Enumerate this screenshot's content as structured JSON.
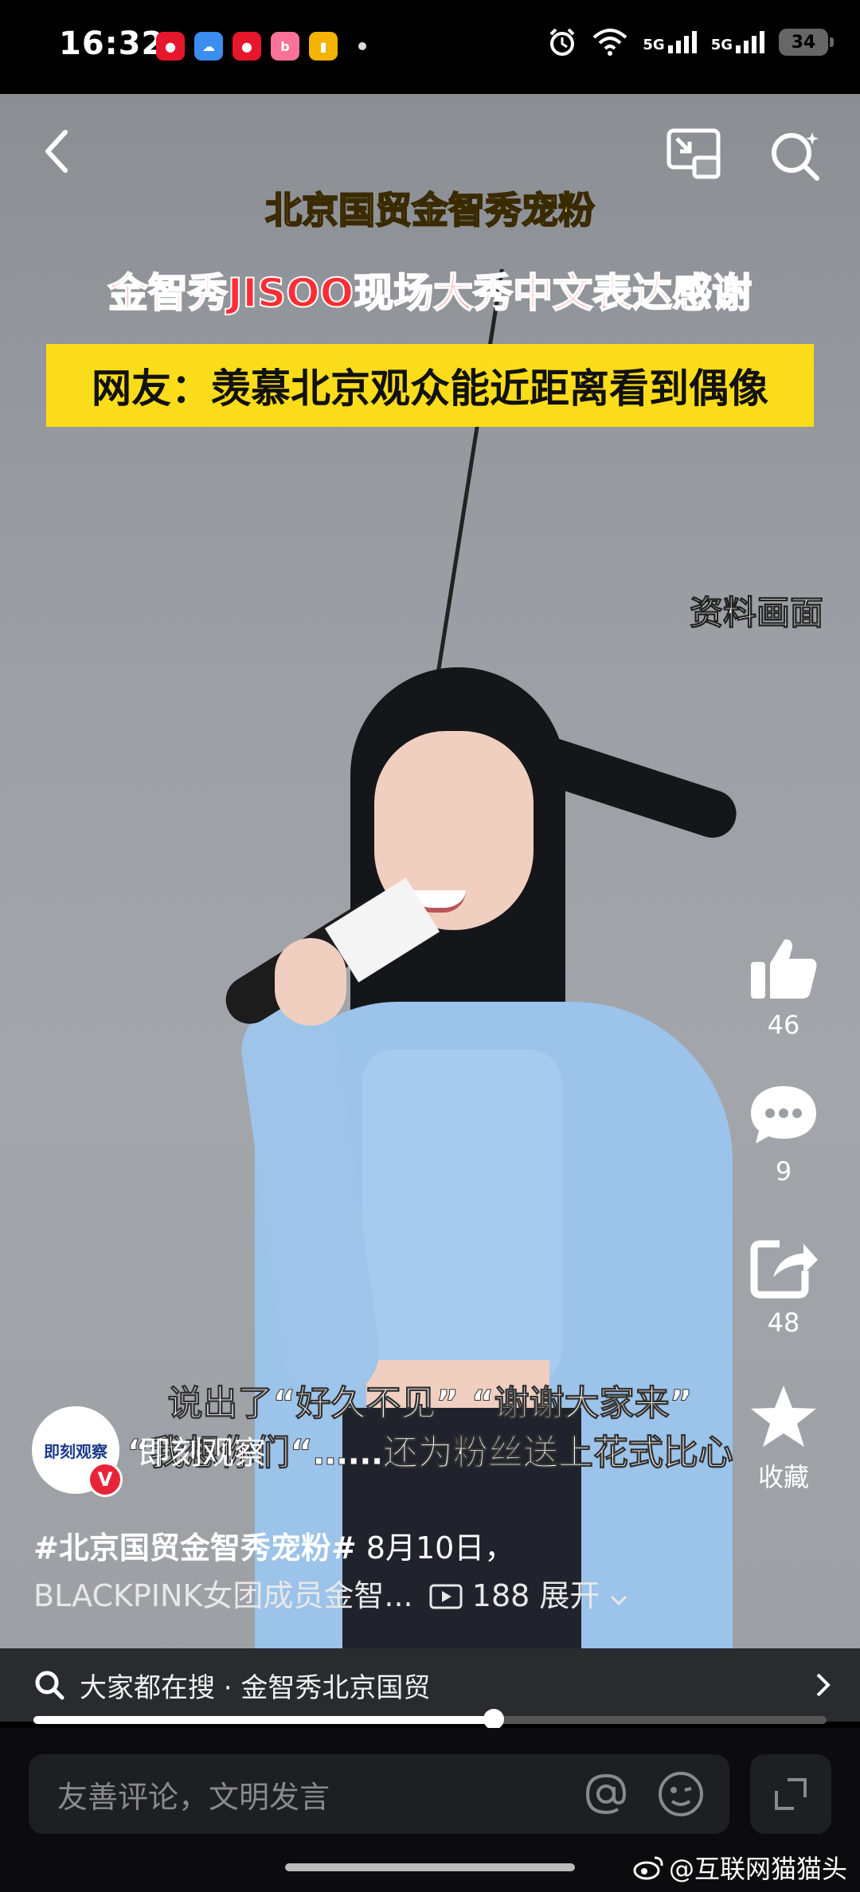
{
  "status_bar": {
    "time": "16:32",
    "battery": "34",
    "network": "5G"
  },
  "video": {
    "caption_title": "北京国贸金智秀宠粉",
    "caption_red": "金智秀JISOO现场大秀中文表达感谢",
    "caption_banner": "网友：羡慕北京观众能近距离看到偶像",
    "archive_label": "资料画面",
    "subtitle_line1": "说出了“好久不见” “谢谢大家来”",
    "subtitle_line2": "“我想你们“……还为粉丝送上花式比心"
  },
  "actions": {
    "likes": "46",
    "comments": "9",
    "shares": "48",
    "favorite_label": "收藏"
  },
  "author": {
    "name": "即刻观察",
    "avatar_text": "即刻观察"
  },
  "description": {
    "hashtag": "#北京国贸金智秀宠粉#",
    "date": " 8月10日，",
    "line2": "BLACKPINK女团成员金智...",
    "views": "188",
    "expand": "展开"
  },
  "search": {
    "query": "大家都在搜 · 金智秀北京国贸"
  },
  "playback": {
    "progress": 0.58
  },
  "comment": {
    "placeholder": "友善评论，文明发言"
  },
  "watermark": "@互联网猫猫头",
  "colors": {
    "caption_yellow": "#fbdc1a",
    "caption_red": "#ff2d35",
    "badge_red": "#e8243b"
  }
}
